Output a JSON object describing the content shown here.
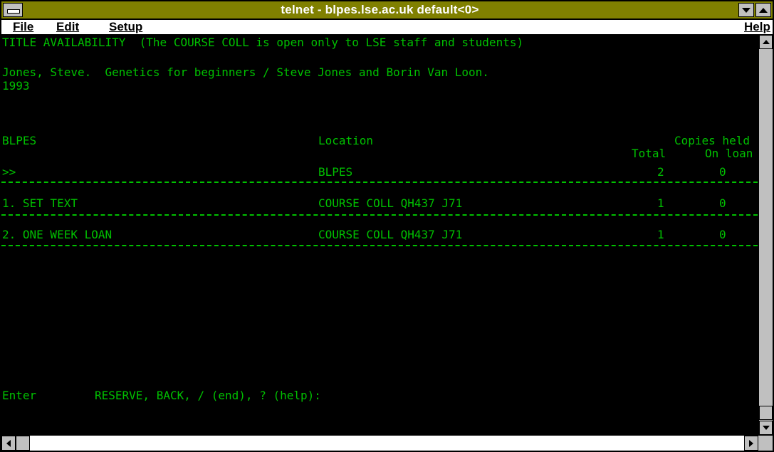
{
  "window": {
    "title": "telnet - blpes.lse.ac.uk default<0>"
  },
  "menu": {
    "file_label": "File",
    "edit_label": "Edit",
    "setup_label": "Setup",
    "help_label": "Help"
  },
  "terminal": {
    "header": "TITLE AVAILABILITY  (The COURSE COLL is open only to LSE staff and students)",
    "citation_line1": "Jones, Steve.  Genetics for beginners / Steve Jones and Borin Van Loon.",
    "citation_line2": "1993",
    "col_library": "BLPES",
    "col_location": "Location",
    "col_copies_held": "Copies held",
    "col_total": "Total",
    "col_on_loan": "On loan",
    "summary_row": {
      "marker": ">>",
      "location": "BLPES",
      "total": "2",
      "on_loan": "0"
    },
    "rows": [
      {
        "label": "1. SET TEXT",
        "location": "COURSE COLL QH437 J71",
        "total": "1",
        "on_loan": "0"
      },
      {
        "label": "2. ONE WEEK LOAN",
        "location": "COURSE COLL QH437 J71",
        "total": "1",
        "on_loan": "0"
      }
    ],
    "prompt_label": "Enter",
    "prompt_options": "RESERVE, BACK, / (end), ? (help):"
  },
  "colors": {
    "terminal_text": "#00c000",
    "terminal_bg": "#000000",
    "titlebar_bg": "#808000",
    "chrome": "#c0c0c0"
  },
  "icons": {
    "system_menu": "system-menu-icon",
    "minimize": "minimize-icon",
    "maximize": "maximize-icon",
    "scroll_up": "arrow-up-icon",
    "scroll_down": "arrow-down-icon",
    "scroll_left": "arrow-left-icon",
    "scroll_right": "arrow-right-icon"
  }
}
